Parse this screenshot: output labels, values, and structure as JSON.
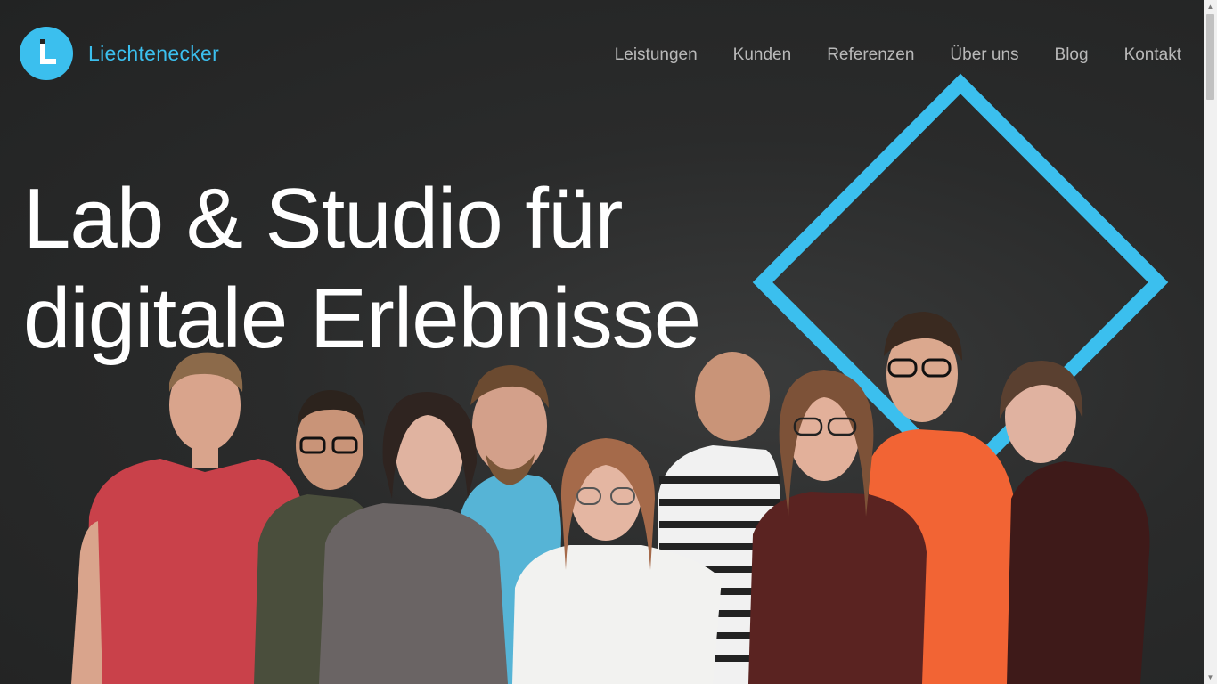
{
  "brand": {
    "name": "Liechtenecker",
    "accent_color": "#3bbfee",
    "logo_icon": "liechtenecker-logo-icon"
  },
  "nav": {
    "items": [
      {
        "label": "Leistungen"
      },
      {
        "label": "Kunden"
      },
      {
        "label": "Referenzen"
      },
      {
        "label": "Über uns"
      },
      {
        "label": "Blog"
      },
      {
        "label": "Kontakt"
      }
    ]
  },
  "hero": {
    "title_line1": "Lab & Studio für",
    "title_line2": "digitale Erlebnisse",
    "background_color": "#232424",
    "image_subject": "team-photo"
  },
  "scrollbar": {
    "up_icon": "scroll-up-arrow-icon",
    "down_icon": "scroll-down-arrow-icon"
  }
}
